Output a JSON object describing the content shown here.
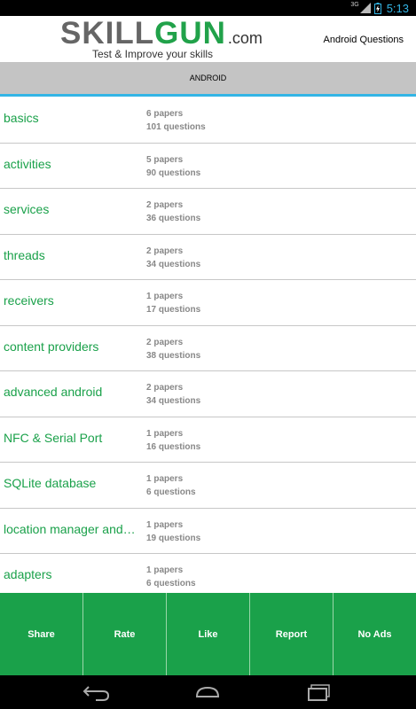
{
  "status_bar": {
    "time": "5:13",
    "signal_label": "3G"
  },
  "header": {
    "logo": {
      "skill": "SKILL",
      "gun": "GUN",
      "com": ".com",
      "tagline": "Test & Improve your skills"
    },
    "title": "Android Questions"
  },
  "tab": {
    "label": "ANDROID"
  },
  "topics": [
    {
      "name": "basics",
      "papers": "6 papers",
      "questions": "101 questions"
    },
    {
      "name": "activities",
      "papers": "5 papers",
      "questions": "90 questions"
    },
    {
      "name": "services",
      "papers": "2 papers",
      "questions": "36 questions"
    },
    {
      "name": "threads",
      "papers": "2 papers",
      "questions": "34 questions"
    },
    {
      "name": "receivers",
      "papers": "1 papers",
      "questions": "17 questions"
    },
    {
      "name": "content providers",
      "papers": "2 papers",
      "questions": "38 questions"
    },
    {
      "name": "advanced android",
      "papers": "2 papers",
      "questions": "34 questions"
    },
    {
      "name": "NFC & Serial Port",
      "papers": "1 papers",
      "questions": "16 questions"
    },
    {
      "name": "SQLite database",
      "papers": "1 papers",
      "questions": "6 questions"
    },
    {
      "name": "location manager and…",
      "papers": "1 papers",
      "questions": "19 questions"
    },
    {
      "name": "adapters",
      "papers": "1 papers",
      "questions": "6 questions"
    }
  ],
  "actions": {
    "share": "Share",
    "rate": "Rate",
    "like": "Like",
    "report": "Report",
    "no_ads": "No Ads"
  },
  "colors": {
    "accent": "#1aa14a",
    "tab_bg": "#c4c4c4",
    "tab_indicator": "#33b5e5",
    "status_time": "#33b5e5"
  }
}
